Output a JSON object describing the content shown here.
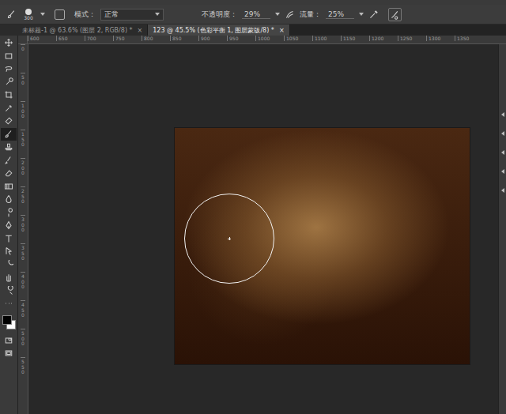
{
  "options_bar": {
    "brush_size": "300",
    "mode_label": "模式：",
    "mode": "正常",
    "opacity_label": "不透明度：",
    "opacity": "29%",
    "flow_label": "流量：",
    "flow": "25%"
  },
  "tabs": [
    {
      "label": "未标题-1 @ 63.6% (图层 2, RGB/8) *",
      "close": "×",
      "selected": false
    },
    {
      "label": "123 @ 45.5% (色彩平衡 1, 图层蒙版/8) *",
      "close": "×",
      "selected": true
    }
  ],
  "ruler": {
    "top": [
      "600",
      "650",
      "700",
      "750",
      "800",
      "850",
      "900",
      "950",
      "1000",
      "1050",
      "1100",
      "1150",
      "1200",
      "1250",
      "1300",
      "1350"
    ],
    "left": [
      "0",
      "50",
      "100",
      "150",
      "200",
      "250",
      "300",
      "350",
      "400",
      "450",
      "500",
      "550"
    ]
  },
  "tools": [
    {
      "kind": "move",
      "selected": false
    },
    {
      "kind": "marquee",
      "selected": false
    },
    {
      "kind": "lasso",
      "selected": false
    },
    {
      "kind": "quickselect",
      "selected": false
    },
    {
      "kind": "crop",
      "selected": false
    },
    {
      "kind": "eyedropper",
      "selected": false
    },
    {
      "kind": "healing",
      "selected": false
    },
    {
      "kind": "brush",
      "selected": true
    },
    {
      "kind": "stamp",
      "selected": false
    },
    {
      "kind": "history",
      "selected": false
    },
    {
      "kind": "eraser",
      "selected": false
    },
    {
      "kind": "gradient",
      "selected": false
    },
    {
      "kind": "blur",
      "selected": false
    },
    {
      "kind": "dodge",
      "selected": false
    },
    {
      "kind": "pen",
      "selected": false
    },
    {
      "kind": "type",
      "selected": false
    },
    {
      "kind": "path",
      "selected": false
    },
    {
      "kind": "shape",
      "selected": false
    },
    {
      "kind": "hand",
      "selected": false
    },
    {
      "kind": "zoom",
      "selected": false
    },
    {
      "kind": "more",
      "selected": false
    }
  ],
  "colors": {
    "foreground": "#000000",
    "background": "#ffffff"
  },
  "canvas": {
    "brush_cursor": true
  }
}
